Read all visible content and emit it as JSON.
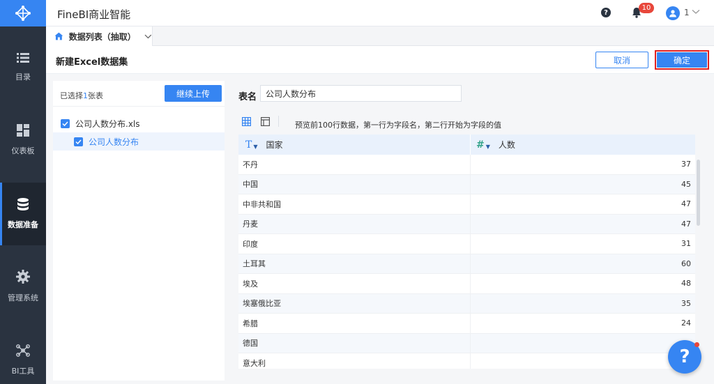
{
  "app": {
    "title": "FineBI商业智能",
    "help_icon_text": "?",
    "notification_count": "10",
    "user_name": "1"
  },
  "icons": {
    "logo": "finebi-logo-icon",
    "help": "question-circle-icon",
    "notifications": "bell-icon",
    "user": "user-avatar-icon",
    "user_menu": "chevron-down-icon",
    "tab_home": "home-icon",
    "view_grid": "grid-view-icon",
    "view_form": "form-view-icon",
    "text_type": "text-type-icon",
    "number_type": "number-type-icon",
    "checked": "checkbox-checked-icon",
    "help_fab": "question-icon"
  },
  "colors": {
    "accent": "#3685f2",
    "nav_bg": "#2a3340",
    "alert": "#e8473b",
    "highlight_border": "#e02020"
  },
  "sidebar": {
    "items": [
      {
        "label": "目录",
        "icon": "list-icon",
        "active": false
      },
      {
        "label": "仪表板",
        "icon": "dashboard-icon",
        "active": false
      },
      {
        "label": "数据准备",
        "icon": "database-icon",
        "active": true
      },
      {
        "label": "管理系统",
        "icon": "gear-icon",
        "active": false
      },
      {
        "label": "BI工具",
        "icon": "network-icon",
        "active": false
      }
    ]
  },
  "tab": {
    "label": "数据列表（抽取）"
  },
  "page": {
    "title": "新建Excel数据集",
    "cancel_label": "取消",
    "confirm_label": "确定"
  },
  "files": {
    "selected_prefix": "已选择",
    "selected_count": "1",
    "selected_suffix": "张表",
    "upload_label": "继续上传",
    "tree": [
      {
        "label": "公司人数分布.xls",
        "checked": true,
        "level": 0
      },
      {
        "label": "公司人数分布",
        "checked": true,
        "level": 1
      }
    ]
  },
  "preview": {
    "table_name_label": "表名",
    "table_name_value": "公司人数分布",
    "hint": "预览前100行数据，第一行为字段名，第二行开始为字段的值",
    "columns": [
      {
        "name": "国家",
        "type": "text",
        "type_glyph": "T"
      },
      {
        "name": "人数",
        "type": "number",
        "type_glyph": "#"
      }
    ],
    "rows": [
      [
        "不丹",
        "37"
      ],
      [
        "中国",
        "45"
      ],
      [
        "中非共和国",
        "47"
      ],
      [
        "丹麦",
        "47"
      ],
      [
        "印度",
        "31"
      ],
      [
        "土耳其",
        "60"
      ],
      [
        "埃及",
        "48"
      ],
      [
        "埃塞俄比亚",
        "35"
      ],
      [
        "希腊",
        "24"
      ],
      [
        "德国",
        ""
      ],
      [
        "意大利",
        ""
      ]
    ]
  },
  "help_fab": {
    "text": "?"
  }
}
